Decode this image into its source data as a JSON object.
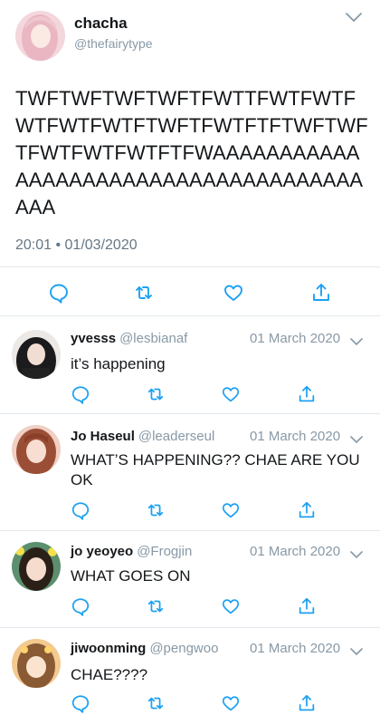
{
  "main_tweet": {
    "name": "chacha",
    "handle": "@thefairytype",
    "text": "TWFTWFTWFTWFTFWTTFWTFWTFWTFWTFWTFTWFTFWTFTFTWFTWFTFWTFWTFWTFTFWAAAAAAAAAAAAAAAAAAAAAAAAAAAAAAAAAAAAAAAA",
    "timestamp": "20:01 • 01/03/2020"
  },
  "replies": [
    {
      "name": "yvesss",
      "handle": "@lesbianaf",
      "date": "01 March 2020",
      "text": "it’s happening"
    },
    {
      "name": "Jo Haseul",
      "handle": "@leaderseul",
      "date": "01 March 2020",
      "text": "WHAT’S HAPPENING?? CHAE ARE YOU OK"
    },
    {
      "name": "jo yeoyeo",
      "handle": "@Frogjin",
      "date": "01 March 2020",
      "text": "WHAT GOES ON"
    },
    {
      "name": "jiwoonming",
      "handle": "@pengwoo",
      "date": "01 March 2020",
      "text": "CHAE????"
    }
  ],
  "icons": {
    "reply": "reply-icon",
    "retweet": "retweet-icon",
    "like": "like-icon",
    "share": "share-icon",
    "menu": "chevron-down-icon"
  },
  "colors": {
    "text": "#14171a",
    "secondary": "#8899a6",
    "icon": "#1da1f2",
    "divider": "#e1e8ed"
  }
}
